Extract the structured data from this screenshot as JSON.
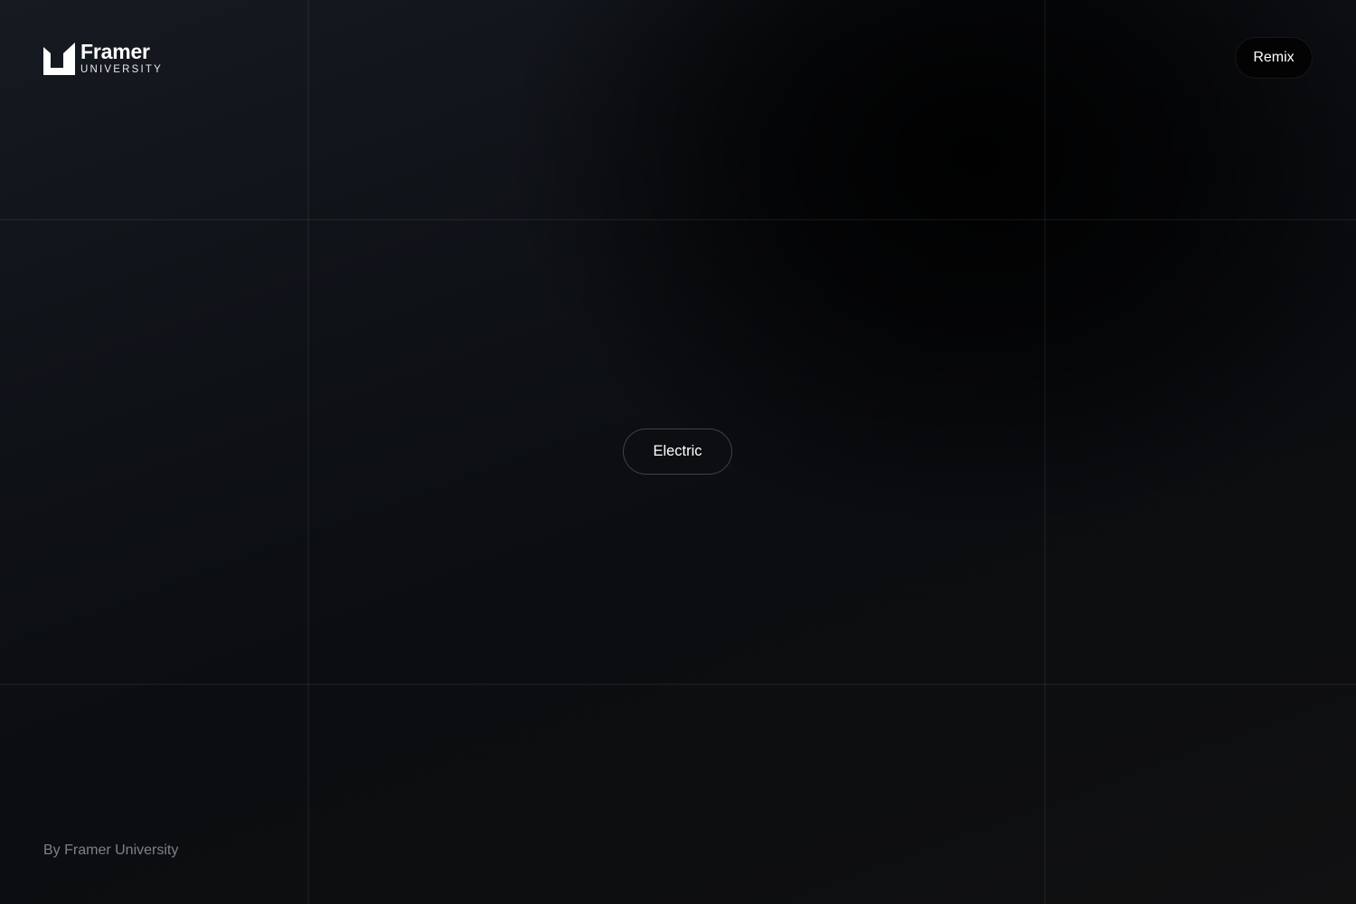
{
  "brand": {
    "name": "Framer",
    "sub": "UNIVERSITY"
  },
  "header": {
    "remix_label": "Remix"
  },
  "main": {
    "button_label": "Electric"
  },
  "footer": {
    "credit": "By Framer University"
  },
  "colors": {
    "background": "#0b0d10",
    "text": "#ffffff",
    "muted_text": "#7d8189"
  },
  "icons": {
    "logo": "framer-university-logo-icon"
  }
}
